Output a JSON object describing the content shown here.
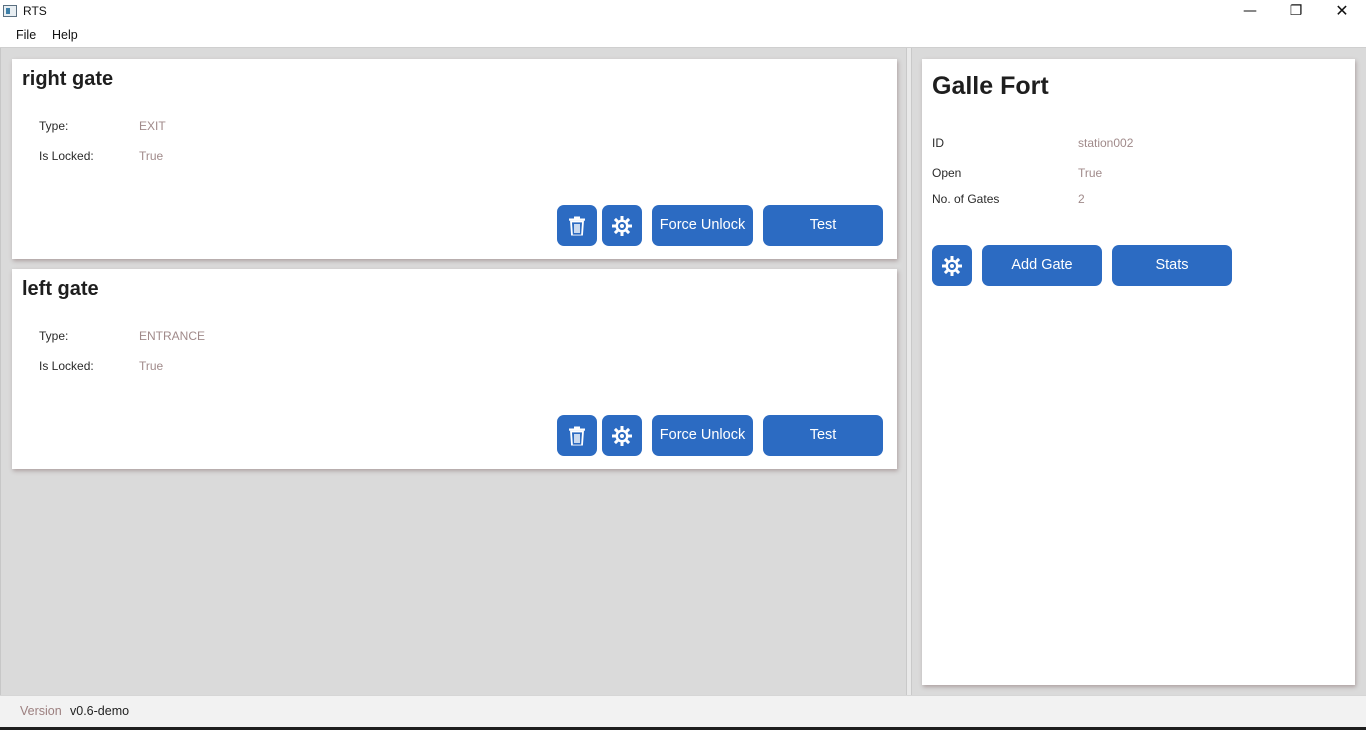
{
  "window": {
    "title": "RTS",
    "minimize_glyph": "—",
    "maximize_glyph": "❐",
    "close_glyph": "✕"
  },
  "menu": {
    "items": [
      {
        "label": "File"
      },
      {
        "label": "Help"
      }
    ]
  },
  "gates": [
    {
      "name": "right gate",
      "type_label": "Type:",
      "type_value": "EXIT",
      "locked_label": "Is Locked:",
      "locked_value": "True",
      "force_unlock_label": "Force Unlock",
      "test_label": "Test",
      "delete_icon": "trash-icon",
      "settings_icon": "gear-icon"
    },
    {
      "name": "left gate",
      "type_label": "Type:",
      "type_value": "ENTRANCE",
      "locked_label": "Is Locked:",
      "locked_value": "True",
      "force_unlock_label": "Force Unlock",
      "test_label": "Test",
      "delete_icon": "trash-icon",
      "settings_icon": "gear-icon"
    }
  ],
  "station": {
    "name": "Galle Fort",
    "id_label": "ID",
    "id_value": "station002",
    "open_label": "Open",
    "open_value": "True",
    "gates_label": "No. of Gates",
    "gates_value": "2",
    "settings_icon": "gear-icon",
    "add_gate_label": "Add Gate",
    "stats_label": "Stats"
  },
  "status": {
    "version_label": "Version",
    "version_value": "v0.6-demo"
  },
  "colors": {
    "accent": "#2c6bc2",
    "value_text": "#a08a8a",
    "panel_bg": "#dadada"
  }
}
